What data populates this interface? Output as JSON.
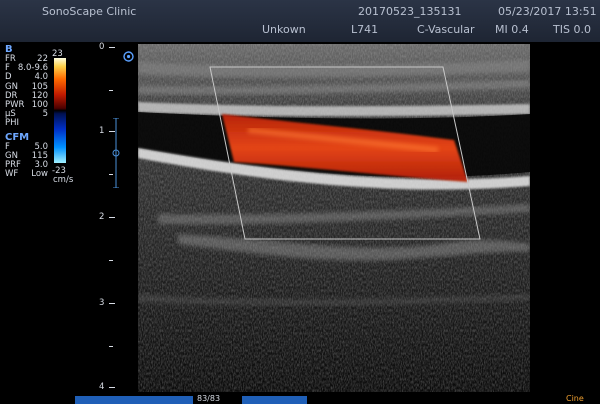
{
  "header": {
    "clinic": "SonoScape Clinic",
    "patient": "Unkown",
    "study_id": "20170523_135131",
    "datetime": "05/23/2017 13:51",
    "probe": "L741",
    "preset": "C-Vascular",
    "mi": "MI 0.4",
    "tis": "TIS 0.0"
  },
  "b_mode": {
    "title": "B",
    "params": [
      {
        "k": "FR",
        "v": "22"
      },
      {
        "k": "F",
        "v": "8.0-9.6"
      },
      {
        "k": "D",
        "v": "4.0"
      },
      {
        "k": "GN",
        "v": "105"
      },
      {
        "k": "DR",
        "v": "120"
      },
      {
        "k": "PWR",
        "v": "100"
      },
      {
        "k": "μS",
        "v": "5"
      },
      {
        "k": "PHI",
        "v": ""
      }
    ]
  },
  "cfm": {
    "title": "CFM",
    "params": [
      {
        "k": "F",
        "v": "5.0"
      },
      {
        "k": "GN",
        "v": "115"
      },
      {
        "k": "PRF",
        "v": "3.0"
      },
      {
        "k": "WF",
        "v": "Low"
      }
    ]
  },
  "color_scale": {
    "max": "23",
    "min": "-23",
    "unit": "cm/s"
  },
  "depth_labels": [
    "0",
    "1",
    "2",
    "3",
    "4"
  ],
  "footer": {
    "frame_counter": "83/83",
    "mode": "Cine"
  },
  "colors": {
    "flow": "#e03a10",
    "header": "#252d3c",
    "accent": "#1f5fb7"
  }
}
